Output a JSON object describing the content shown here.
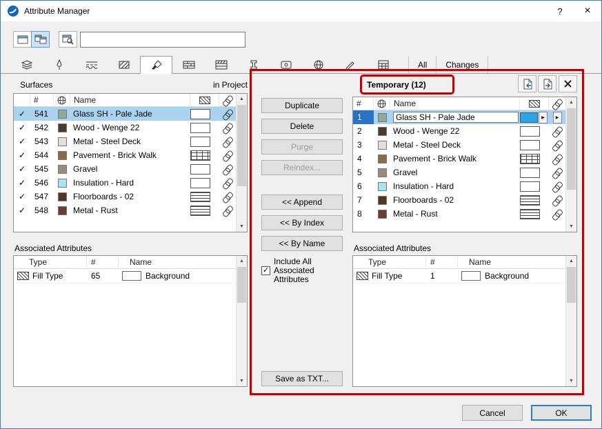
{
  "window": {
    "title": "Attribute Manager",
    "help_label": "?",
    "close_label": "×"
  },
  "glyphs": {
    "check": "✓",
    "up_arrow": "▲",
    "down_arrow": "▼",
    "popup_arrow": "▶"
  },
  "toolbar": {
    "filter_value": ""
  },
  "tabbar": {
    "all_label": "All",
    "changes_label": "Changes"
  },
  "left_panel": {
    "title": "Surfaces",
    "scope_label": "in Project",
    "columns": {
      "num": "#",
      "name": "Name"
    },
    "assoc_title": "Associated Attributes",
    "assoc_columns": {
      "type": "Type",
      "num": "#",
      "name": "Name"
    },
    "assoc_row": {
      "type": "Fill Type",
      "num": "65",
      "name": "Background"
    }
  },
  "right_panel": {
    "title": "Temporary (12)",
    "columns": {
      "num": "#",
      "name": "Name"
    },
    "selected_fill_color": "#2aa3e8",
    "assoc_title": "Associated Attributes",
    "assoc_columns": {
      "type": "Type",
      "num": "#",
      "name": "Name"
    },
    "assoc_row": {
      "type": "Fill Type",
      "num": "1",
      "name": "Background"
    }
  },
  "surfaces": [
    {
      "num": "541",
      "idx": "1",
      "name": "Glass SH - Pale Jade",
      "color": "#8ea89a",
      "fill": "fill-plain"
    },
    {
      "num": "542",
      "idx": "2",
      "name": "Wood - Wenge 22",
      "color": "#4f3929",
      "fill": "fill-plain"
    },
    {
      "num": "543",
      "idx": "3",
      "name": "Metal - Steel Deck",
      "color": "#e6dedd",
      "fill": "fill-plain"
    },
    {
      "num": "544",
      "idx": "4",
      "name": "Pavement - Brick Walk",
      "color": "#8c6a49",
      "fill": "fill-brick"
    },
    {
      "num": "545",
      "idx": "5",
      "name": "Gravel",
      "color": "#9b8b7b",
      "fill": "fill-plain"
    },
    {
      "num": "546",
      "idx": "6",
      "name": "Insulation - Hard",
      "color": "#a9e4f5",
      "fill": "fill-plain"
    },
    {
      "num": "547",
      "idx": "7",
      "name": "Floorboards - 02",
      "color": "#56361f",
      "fill": "fill-hlines"
    },
    {
      "num": "548",
      "idx": "8",
      "name": "Metal - Rust",
      "color": "#6d3c32",
      "fill": "fill-hlines"
    }
  ],
  "middle": {
    "duplicate": "Duplicate",
    "delete": "Delete",
    "purge": "Purge",
    "reindex": "Reindex...",
    "append": "<< Append",
    "by_index": "<< By Index",
    "by_name": "<< By Name",
    "include_label": "Include All Associated Attributes",
    "save_txt": "Save as TXT..."
  },
  "footer": {
    "cancel": "Cancel",
    "ok": "OK"
  },
  "colors": {
    "selection": "#a9d3f0",
    "annotation": "#c40000",
    "accent": "#2b7cd3"
  }
}
